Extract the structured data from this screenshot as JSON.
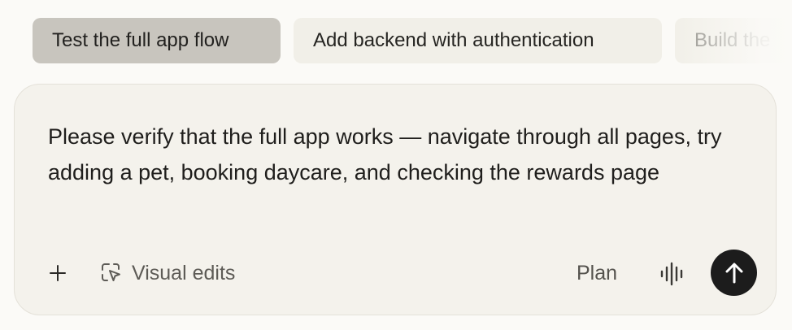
{
  "suggestions": {
    "items": [
      {
        "label": "Test the full app flow",
        "active": true
      },
      {
        "label": "Add backend with authentication",
        "active": false
      },
      {
        "label": "Build the",
        "active": false
      }
    ]
  },
  "composer": {
    "message": "Please verify that the full app works — navigate through all pages, try adding a pet, booking daycare, and checking the rewards page",
    "toolbar": {
      "add_icon": "plus-icon",
      "visual_edits_label": "Visual edits",
      "visual_edits_icon": "dashed-cursor-icon",
      "plan_label": "Plan",
      "voice_icon": "audio-waveform-icon",
      "send_icon": "arrow-up-icon"
    }
  },
  "colors": {
    "page_background": "#fbfaf7",
    "chip_background": "#f1efe8",
    "chip_active_background": "#c8c5be",
    "composer_background": "#f4f2ec",
    "send_button": "#1c1c1c"
  }
}
